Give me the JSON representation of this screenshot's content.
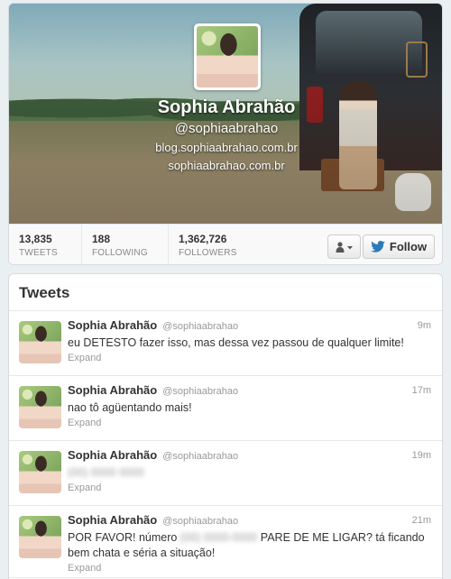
{
  "profile": {
    "name": "Sophia Abrahão",
    "handle": "@sophiaabrahao",
    "links": [
      "blog.sophiaabrahao.com.br",
      "sophiaabrahao.com.br"
    ]
  },
  "stats": {
    "tweets": {
      "value": "13,835",
      "label": "TWEETS"
    },
    "following": {
      "value": "188",
      "label": "FOLLOWING"
    },
    "followers": {
      "value": "1,362,726",
      "label": "FOLLOWERS"
    }
  },
  "actions": {
    "follow_label": "Follow",
    "user_icon": "person-icon",
    "follow_icon": "twitter-bird-icon"
  },
  "colors": {
    "twitter_blue": "#2b7bb9",
    "link_gray": "#999999"
  },
  "timeline": {
    "heading": "Tweets",
    "expand_label": "Expand",
    "tweets": [
      {
        "name": "Sophia Abrahão",
        "handle": "@sophiaabrahao",
        "time": "9m",
        "text": "eu DETESTO fazer isso, mas dessa vez passou de qualquer limite!"
      },
      {
        "name": "Sophia Abrahão",
        "handle": "@sophiaabrahao",
        "time": "17m",
        "text": "nao tô agüentando mais!"
      },
      {
        "name": "Sophia Abrahão",
        "handle": "@sophiaabrahao",
        "time": "19m",
        "text": ""
      },
      {
        "name": "Sophia Abrahão",
        "handle": "@sophiaabrahao",
        "time": "21m",
        "text_before": "POR FAVOR! número",
        "text_after": "PARE DE ME LIGAR? tá ficando bem chata e séria a situação!"
      }
    ]
  }
}
